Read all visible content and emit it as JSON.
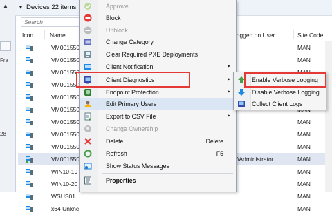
{
  "left_panel": {
    "arrow": "▲",
    "fragment_1": "Fra",
    "fragment_2": "28"
  },
  "devices_header": {
    "chevron": "▾",
    "title": "Devices 22 items"
  },
  "search": {
    "placeholder": "Search"
  },
  "columns": {
    "icon": "Icon",
    "name": "Name",
    "logged_on_user": "Logged on User",
    "site_code": "Site Code"
  },
  "rows": [
    {
      "name": "VM001550",
      "user": "",
      "site": "MAN"
    },
    {
      "name": "VM001550",
      "user": "",
      "site": "MAN"
    },
    {
      "name": "VM001550",
      "user": "",
      "site": "MAN"
    },
    {
      "name": "VM001550",
      "user": "",
      "site": "MAN"
    },
    {
      "name": "VM001550",
      "user": "",
      "site": "MAN"
    },
    {
      "name": "VM001550",
      "user": "",
      "site": "MAN"
    },
    {
      "name": "VM001550",
      "user": "",
      "site": "MAN"
    },
    {
      "name": "VM001550",
      "user": "",
      "site": "MAN"
    },
    {
      "name": "VM001550",
      "user": "",
      "site": "MAN"
    },
    {
      "name": "VM001550",
      "user": "N\\Administrator",
      "site": "MAN"
    },
    {
      "name": "WIN10-19",
      "user": "",
      "site": "MAN"
    },
    {
      "name": "WIN10-20",
      "user": "",
      "site": "MAN"
    },
    {
      "name": "WSUS01",
      "user": "",
      "site": "MAN"
    },
    {
      "name": "x64 Unknc",
      "user": "",
      "site": "MAN"
    }
  ],
  "context_menu": {
    "approve": "Approve",
    "block": "Block",
    "unblock": "Unblock",
    "change_category": "Change Category",
    "clear_pxe": "Clear Required PXE Deployments",
    "client_notification": "Client Notification",
    "client_diagnostics": "Client Diagnostics",
    "endpoint_protection": "Endpoint Protection",
    "edit_primary_users": "Edit Primary Users",
    "export_csv": "Export to CSV File",
    "change_ownership": "Change Ownership",
    "delete": "Delete",
    "delete_shortcut": "Delete",
    "refresh": "Refresh",
    "refresh_shortcut": "F5",
    "show_status": "Show Status Messages",
    "properties": "Properties",
    "submenu_arrow": "▸"
  },
  "submenu": {
    "enable_verbose": "Enable Verbose Logging",
    "disable_verbose": "Disable Verbose Logging",
    "collect_logs": "Collect Client Logs"
  },
  "colors": {
    "highlight_red": "#e53935",
    "selected_row": "#dfe6f2",
    "menu_bg": "#f5f5f5"
  }
}
